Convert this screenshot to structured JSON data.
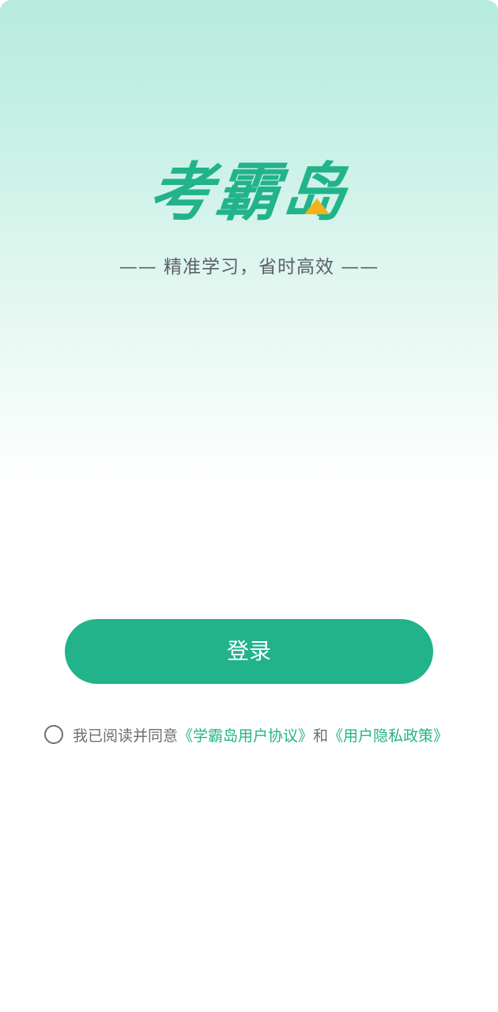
{
  "brand": {
    "logo_text": "考霸岛",
    "slogan": "—— 精准学习，省时高效 ——",
    "primary_color": "#22b38b",
    "accent_color": "#f2b21b"
  },
  "login": {
    "button_label": "登录"
  },
  "agreement": {
    "checked": false,
    "prefix": "我已阅读并同意",
    "user_agreement": "《学霸岛用户协议》",
    "conjunction": "和",
    "privacy_policy": "《用户隐私政策》"
  }
}
